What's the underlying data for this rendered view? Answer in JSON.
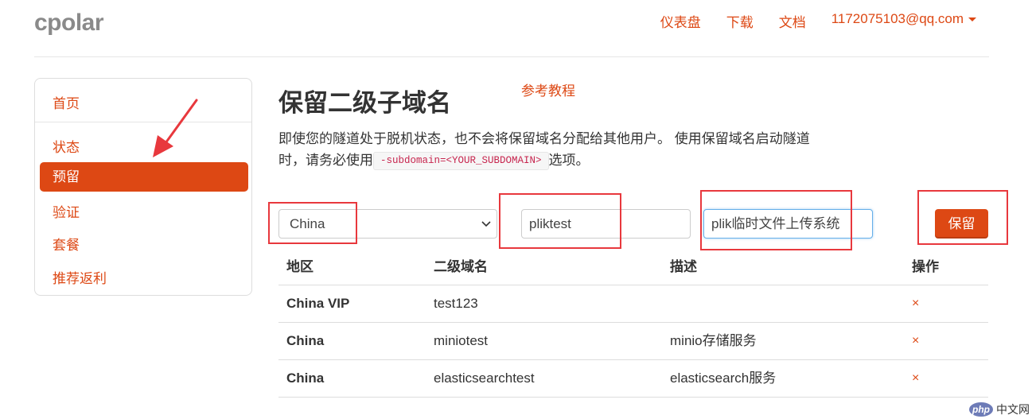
{
  "brand": "cpolar",
  "topnav": {
    "dashboard": "仪表盘",
    "download": "下载",
    "docs": "文档",
    "account": "1172075103@qq.com"
  },
  "sidebar": {
    "items": [
      {
        "label": "首页"
      },
      {
        "label": "状态"
      },
      {
        "label": "预留",
        "active": true
      },
      {
        "label": "验证"
      },
      {
        "label": "套餐"
      },
      {
        "label": "推荐返利"
      }
    ]
  },
  "page": {
    "title": "保留二级子域名",
    "tutorial_link": "参考教程",
    "desc_line1": "即使您的隧道处于脱机状态，也不会将保留域名分配给其他用户。 使用保留域名启动隧道",
    "desc_line2_pre": "时，请务必使用",
    "desc_code": "-subdomain=<YOUR_SUBDOMAIN>",
    "desc_line2_post": "选项。"
  },
  "form": {
    "region": "China",
    "subdomain_value": "pliktest",
    "description_value": "plik临时文件上传系统",
    "save_label": "保留"
  },
  "table": {
    "headers": {
      "region": "地区",
      "subdomain": "二级域名",
      "description": "描述",
      "action": "操作"
    },
    "rows": [
      {
        "region": "China VIP",
        "subdomain": "test123",
        "description": "",
        "action": "×"
      },
      {
        "region": "China",
        "subdomain": "miniotest",
        "description": "minio存储服务",
        "action": "×"
      },
      {
        "region": "China",
        "subdomain": "elasticsearchtest",
        "description": "elasticsearch服务",
        "action": "×"
      }
    ]
  },
  "watermark": {
    "logo": "php",
    "text": "中文网"
  },
  "colors": {
    "accent": "#dd4814",
    "highlight_box": "#e8383d"
  }
}
